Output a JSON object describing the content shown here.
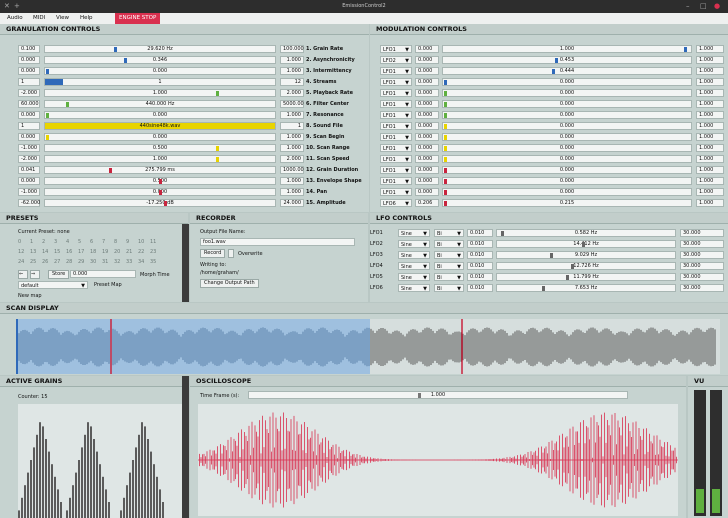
{
  "window": {
    "title": "EmissionControl2"
  },
  "menu": {
    "items": [
      "Audio",
      "MIDI",
      "View",
      "Help"
    ],
    "engine_stop": "ENGINE STOP"
  },
  "granulation": {
    "title": "GRANULATION CONTROLS",
    "rows": [
      {
        "min": "0.100",
        "value": "29.620 Hz",
        "max": "100.000",
        "name": "1. Grain Rate",
        "knob": 0.3,
        "color": "#2f69b9"
      },
      {
        "min": "0.000",
        "value": "0.346",
        "max": "1.000",
        "name": "2. Asynchronicity",
        "knob": 0.346,
        "color": "#2f69b9"
      },
      {
        "min": "0.000",
        "value": "0.000",
        "max": "1.000",
        "name": "3. Intermittency",
        "knob": 0.0,
        "color": "#2f69b9"
      },
      {
        "min": "1",
        "value": "1",
        "max": "12",
        "name": "4. Streams",
        "knob": 0.0,
        "color": "#2f69b9",
        "fill": 0.08
      },
      {
        "min": "-2.000",
        "value": "1.000",
        "max": "2.000",
        "name": "5. Playback Rate",
        "knob": 0.75,
        "color": "#5fb040"
      },
      {
        "min": "60.000",
        "value": "440.000 Hz",
        "max": "5000.00",
        "name": "6. Filter Center",
        "knob": 0.09,
        "color": "#5fb040"
      },
      {
        "min": "0.000",
        "value": "0.000",
        "max": "1.000",
        "name": "7. Resonance",
        "knob": 0.0,
        "color": "#5fb040"
      },
      {
        "min": "1",
        "value": "440sine48k.wav",
        "max": "1",
        "name": "8. Sound File",
        "knob": 1.0,
        "color": "#e8d400",
        "fill": 1.0
      },
      {
        "min": "0.000",
        "value": "0.000",
        "max": "1.000",
        "name": "9. Scan Begin",
        "knob": 0.0,
        "color": "#e8d400"
      },
      {
        "min": "-1.000",
        "value": "0.500",
        "max": "1.000",
        "name": "10. Scan Range",
        "knob": 0.75,
        "color": "#e8d400"
      },
      {
        "min": "-2.000",
        "value": "1.000",
        "max": "2.000",
        "name": "11. Scan Speed",
        "knob": 0.75,
        "color": "#e8d400"
      },
      {
        "min": "0.041",
        "value": "275.799 ms",
        "max": "1000.00",
        "name": "12. Grain Duration",
        "knob": 0.28,
        "color": "#c8243e"
      },
      {
        "min": "0.000",
        "value": "0.500",
        "max": "1.000",
        "name": "13. Envelope Shape",
        "knob": 0.5,
        "color": "#c8243e"
      },
      {
        "min": "-1.000",
        "value": "0.000",
        "max": "1.000",
        "name": "14. Pan",
        "knob": 0.5,
        "color": "#c8243e"
      },
      {
        "min": "-62.000",
        "value": "-17.250 dB",
        "max": "24.000",
        "name": "15. Amplitude",
        "knob": 0.52,
        "color": "#c8243e"
      }
    ]
  },
  "modulation": {
    "title": "MODULATION CONTROLS",
    "rows": [
      {
        "lfo": "LFO1",
        "depth": "0.000",
        "value": "1.000",
        "max": "1.000",
        "knob": 1.0,
        "color": "#2f69b9"
      },
      {
        "lfo": "LFO2",
        "depth": "0.000",
        "value": "0.453",
        "max": "1.000",
        "knob": 0.453,
        "color": "#2f69b9"
      },
      {
        "lfo": "LFO1",
        "depth": "0.000",
        "value": "0.444",
        "max": "1.000",
        "knob": 0.444,
        "color": "#2f69b9"
      },
      {
        "lfo": "LFO1",
        "depth": "0.000",
        "value": "0.000",
        "max": "1.000",
        "knob": 0.0,
        "color": "#2f69b9"
      },
      {
        "lfo": "LFO1",
        "depth": "0.000",
        "value": "0.000",
        "max": "1.000",
        "knob": 0.0,
        "color": "#5fb040"
      },
      {
        "lfo": "LFO1",
        "depth": "0.000",
        "value": "0.000",
        "max": "1.000",
        "knob": 0.0,
        "color": "#5fb040"
      },
      {
        "lfo": "LFO1",
        "depth": "0.000",
        "value": "0.000",
        "max": "1.000",
        "knob": 0.0,
        "color": "#5fb040"
      },
      {
        "lfo": "LFO1",
        "depth": "0.000",
        "value": "0.000",
        "max": "1.000",
        "knob": 0.0,
        "color": "#e8d400"
      },
      {
        "lfo": "LFO1",
        "depth": "0.000",
        "value": "0.000",
        "max": "1.000",
        "knob": 0.0,
        "color": "#e8d400"
      },
      {
        "lfo": "LFO1",
        "depth": "0.000",
        "value": "0.000",
        "max": "1.000",
        "knob": 0.0,
        "color": "#e8d400"
      },
      {
        "lfo": "LFO1",
        "depth": "0.000",
        "value": "0.000",
        "max": "1.000",
        "knob": 0.0,
        "color": "#e8d400"
      },
      {
        "lfo": "LFO1",
        "depth": "0.000",
        "value": "0.000",
        "max": "1.000",
        "knob": 0.0,
        "color": "#c8243e"
      },
      {
        "lfo": "LFO1",
        "depth": "0.000",
        "value": "0.000",
        "max": "1.000",
        "knob": 0.0,
        "color": "#c8243e"
      },
      {
        "lfo": "LFO1",
        "depth": "0.000",
        "value": "0.000",
        "max": "1.000",
        "knob": 0.0,
        "color": "#c8243e"
      },
      {
        "lfo": "LFO6",
        "depth": "0.206",
        "value": "0.215",
        "max": "1.000",
        "knob": 0.0,
        "color": "#c8243e"
      }
    ]
  },
  "presets": {
    "title": "PRESETS",
    "current": "Current Preset: none",
    "grid": [
      [
        "0",
        "1",
        "2",
        "3",
        "4",
        "5",
        "6",
        "7",
        "8",
        "9",
        "10",
        "11"
      ],
      [
        "12",
        "13",
        "14",
        "15",
        "16",
        "17",
        "18",
        "19",
        "20",
        "21",
        "22",
        "23"
      ],
      [
        "24",
        "25",
        "26",
        "27",
        "28",
        "29",
        "30",
        "31",
        "32",
        "33",
        "34",
        "35"
      ]
    ],
    "store_label": "Store",
    "store_value": "0.000",
    "morph_label": "Morph Time",
    "map_value": "default",
    "preset_map_label": "Preset Map",
    "new_map_label": "New map"
  },
  "recorder": {
    "title": "RECORDER",
    "output_label": "Output File Name:",
    "filename": "foo1.wav",
    "record_label": "Record",
    "overwrite_label": "Overwrite",
    "writing_label": "Writing to:",
    "path": "/home/graham/",
    "change_path_label": "Change Output Path"
  },
  "lfo": {
    "title": "LFO CONTROLS",
    "rows": [
      {
        "name": "LFO1",
        "shape": "Sine",
        "pol": "Bi",
        "min": "0.010",
        "value": "0.582 Hz",
        "max": "30.000",
        "knob": 0.02
      },
      {
        "name": "LFO2",
        "shape": "Sine",
        "pol": "Bi",
        "min": "0.010",
        "value": "14.412 Hz",
        "max": "30.000",
        "knob": 0.48
      },
      {
        "name": "LFO3",
        "shape": "Sine",
        "pol": "Bi",
        "min": "0.010",
        "value": "9.029 Hz",
        "max": "30.000",
        "knob": 0.3
      },
      {
        "name": "LFO4",
        "shape": "Sine",
        "pol": "Bi",
        "min": "0.010",
        "value": "12.726 Hz",
        "max": "30.000",
        "knob": 0.42
      },
      {
        "name": "LFO5",
        "shape": "Sine",
        "pol": "Bi",
        "min": "0.010",
        "value": "11.799 Hz",
        "max": "30.000",
        "knob": 0.39
      },
      {
        "name": "LFO6",
        "shape": "Sine",
        "pol": "Bi",
        "min": "0.010",
        "value": "7.653 Hz",
        "max": "30.000",
        "knob": 0.25
      }
    ]
  },
  "scan": {
    "title": "SCAN DISPLAY"
  },
  "active": {
    "title": "ACTIVE GRAINS",
    "counter": "Counter: 15"
  },
  "scope": {
    "title": "OSCILLOSCOPE",
    "timeframe_label": "Time Frame (s):",
    "timeframe_value": "1.000",
    "timeframe_fraction": 0.45
  },
  "vu": {
    "title": "VU"
  }
}
